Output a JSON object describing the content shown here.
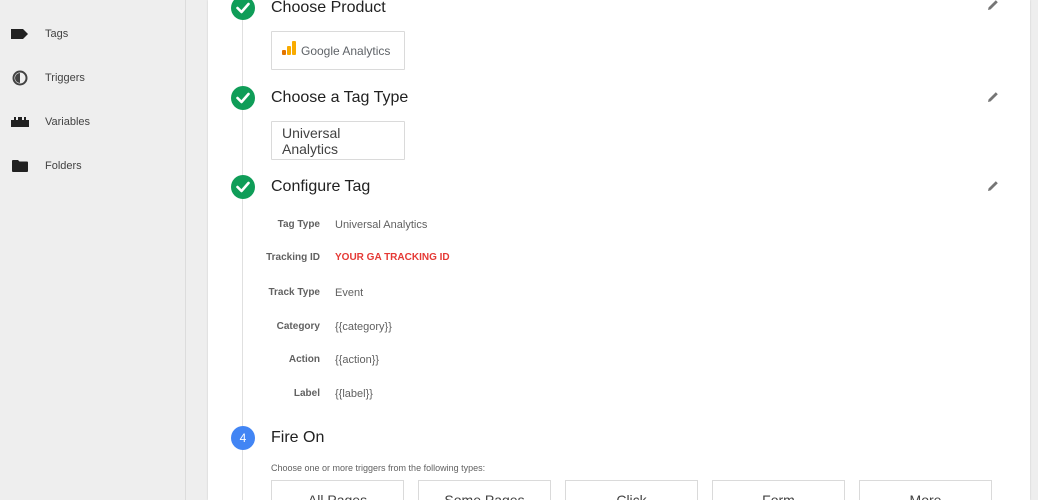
{
  "sidebar": {
    "items": [
      {
        "label": "Tags",
        "icon": "tag-icon"
      },
      {
        "label": "Triggers",
        "icon": "trigger-icon"
      },
      {
        "label": "Variables",
        "icon": "variables-icon"
      },
      {
        "label": "Folders",
        "icon": "folder-icon"
      }
    ]
  },
  "steps": {
    "product": {
      "title": "Choose Product",
      "chip": "Google Analytics"
    },
    "tag_type": {
      "title": "Choose a Tag Type",
      "chip": "Universal Analytics"
    },
    "configure": {
      "title": "Configure Tag",
      "fields": [
        {
          "label": "Tag Type",
          "value": "Universal Analytics"
        },
        {
          "label": "Tracking ID",
          "value": "YOUR GA TRACKING ID"
        },
        {
          "label": "Track Type",
          "value": "Event"
        },
        {
          "label": "Category",
          "value": "{{category}}"
        },
        {
          "label": "Action",
          "value": "{{action}}"
        },
        {
          "label": "Label",
          "value": "{{label}}"
        }
      ]
    },
    "fire_on": {
      "number": "4",
      "title": "Fire On",
      "hint": "Choose one or more triggers from the following types:",
      "triggers": [
        "All Pages",
        "Some Pages",
        "Click",
        "Form",
        "More"
      ]
    }
  },
  "colors": {
    "done": "#0f9d58",
    "step_number": "#4285f4",
    "tracking_id": "#e53935",
    "ga_logo_orange": "#f9ab00",
    "ga_logo_dark_orange": "#e37400"
  }
}
